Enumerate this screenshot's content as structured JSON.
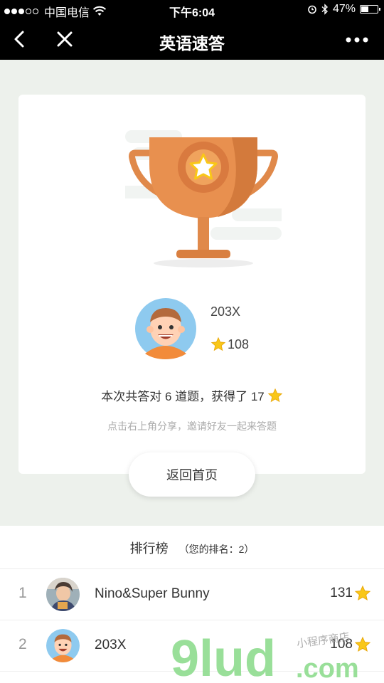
{
  "status_bar": {
    "carrier": "中国电信",
    "time": "下午6:04",
    "battery": "47%",
    "battery_level": 0.47,
    "icons": [
      "signal-dots",
      "wifi-icon",
      "alarm-icon",
      "bluetooth-icon",
      "battery-icon"
    ]
  },
  "nav": {
    "title": "英语速答",
    "icons": [
      "back-icon",
      "close-icon",
      "more-icon"
    ]
  },
  "result": {
    "user_name": "203X",
    "user_score": "108",
    "summary_text": "本次共答对 6 道题，获得了 17",
    "hint": "点击右上角分享，邀请好友一起来答题",
    "home_button": "返回首页"
  },
  "ranking": {
    "title": "排行榜",
    "my_rank_label": "（您的排名：2）",
    "rows": [
      {
        "rank": "1",
        "name": "Nino&Super Bunny",
        "score": "131"
      },
      {
        "rank": "2",
        "name": "203X",
        "score": "108"
      }
    ]
  },
  "watermark": {
    "text": "9lud.com",
    "caption": "小程序商店"
  },
  "colors": {
    "bar_bg": "#000000",
    "page_bg": "#edf1ec",
    "trophy": "#e0894a",
    "star": "#f9c718",
    "watermark_green": "#8fdc8f"
  }
}
